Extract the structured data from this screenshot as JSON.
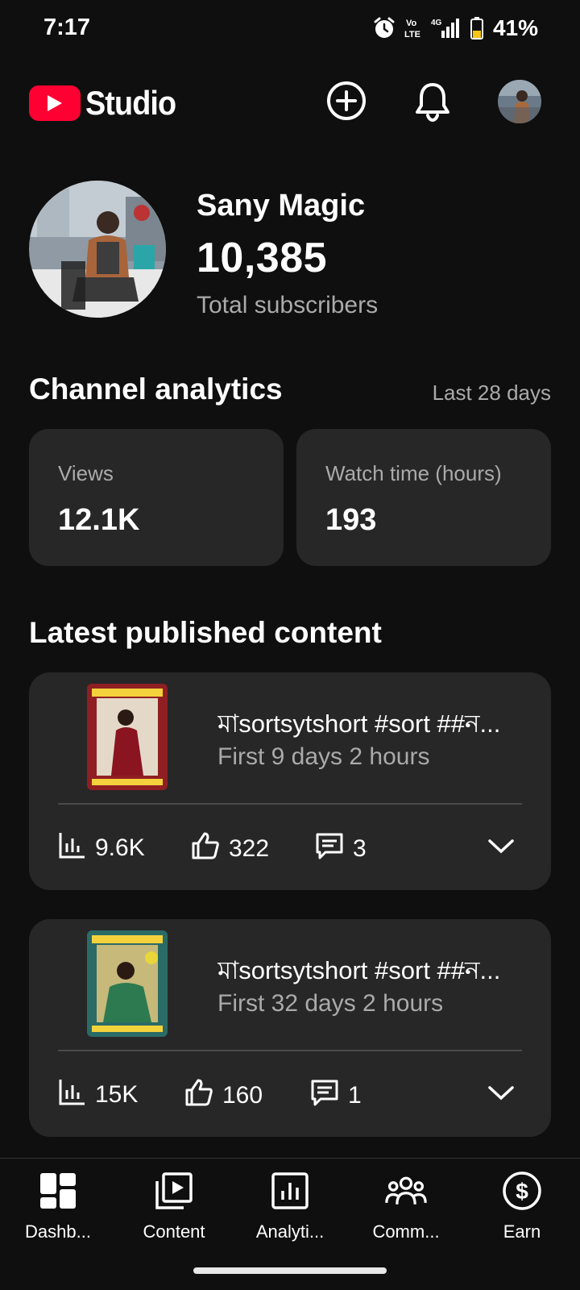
{
  "status_bar": {
    "time": "7:17",
    "volte": "Vo LTE",
    "network": "4G",
    "battery_pct": "41%",
    "battery_level": 0.41
  },
  "header": {
    "app_name": "Studio",
    "create_icon": "plus-circle-icon",
    "notifications_icon": "bell-icon"
  },
  "profile": {
    "name": "Sany Magic",
    "subscribers": "10,385",
    "subscribers_label": "Total subscribers"
  },
  "analytics": {
    "title": "Channel analytics",
    "period": "Last 28 days",
    "metrics": [
      {
        "label": "Views",
        "value": "12.1K"
      },
      {
        "label": "Watch time (hours)",
        "value": "193"
      }
    ]
  },
  "latest": {
    "title": "Latest published content",
    "items": [
      {
        "title": "মাsortsytshort #sort ##ন...",
        "subtitle": "First 9 days 2 hours",
        "views": "9.6K",
        "likes": "322",
        "comments": "3",
        "thumb_bg": "#8f1f22"
      },
      {
        "title": "মাsortsytshort #sort ##ন...",
        "subtitle": "First 32 days 2 hours",
        "views": "15K",
        "likes": "160",
        "comments": "1",
        "thumb_bg": "#2a6b66"
      }
    ]
  },
  "nav": {
    "items": [
      {
        "label": "Dashb...",
        "icon": "dashboard-icon"
      },
      {
        "label": "Content",
        "icon": "content-icon"
      },
      {
        "label": "Analyti...",
        "icon": "analytics-icon"
      },
      {
        "label": "Comm...",
        "icon": "community-icon"
      },
      {
        "label": "Earn",
        "icon": "earn-icon"
      }
    ]
  },
  "colors": {
    "background": "#0f0f0f",
    "card": "#272727",
    "brand_red": "#ff0033",
    "secondary_text": "#aaaaaa"
  }
}
